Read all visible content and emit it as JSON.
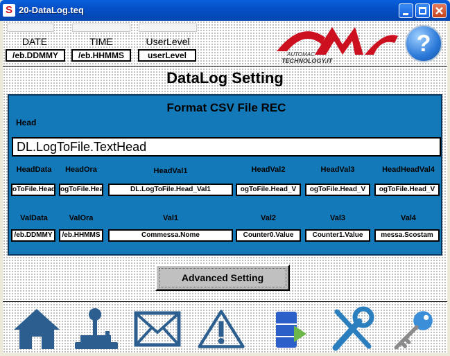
{
  "window": {
    "title": "20-DataLog.teq",
    "app_icon": "S"
  },
  "header": {
    "date_label": "DATE",
    "date_value": "/eb.DDMMY",
    "time_label": "TIME",
    "time_value": "/eb.HHMMS",
    "user_label": "UserLevel",
    "user_value": "userLevel",
    "help_glyph": "?"
  },
  "page": {
    "title": "DataLog Setting"
  },
  "panel": {
    "title": "Format CSV File REC",
    "head_label": "Head",
    "head_value": "DL.LogToFile.TextHead",
    "head_columns": [
      {
        "label": "HeadData",
        "value": "oToFile.Head"
      },
      {
        "label": "HeadOra",
        "value": "ogToFile.Hea"
      },
      {
        "label": "HeadVal1",
        "value": "DL.LogToFile.Head_Val1"
      },
      {
        "label": "HeadVal2",
        "value": "ogToFile.Head_V"
      },
      {
        "label": "HeadVal3",
        "value": "ogToFile.Head_V"
      },
      {
        "label": "HeadHeadVal4",
        "value": "ogToFile.Head_V"
      }
    ],
    "val_columns": [
      {
        "label": "ValData",
        "value": "/eb.DDMMY"
      },
      {
        "label": "ValOra",
        "value": "/eb.HHMMS"
      },
      {
        "label": "Val1",
        "value": "Commessa.Nome"
      },
      {
        "label": "Val2",
        "value": "Counter0.Value"
      },
      {
        "label": "Val3",
        "value": "Counter1.Value"
      },
      {
        "label": "Val4",
        "value": "messa.Scostam"
      }
    ]
  },
  "buttons": {
    "advanced": "Advanced Setting"
  },
  "logo": {
    "line1": "AUTOMAC",
    "line2": "TECHNOLOGY.IT"
  },
  "colors": {
    "panel": "#1479b8",
    "nav_icon": "#2c5f8f",
    "logo_red": "#cc1020",
    "title_bar": "#0a5fdc"
  },
  "nav": [
    "home-icon",
    "joystick-icon",
    "mail-icon",
    "warning-icon",
    "database-icon",
    "tools-icon",
    "key-icon"
  ]
}
